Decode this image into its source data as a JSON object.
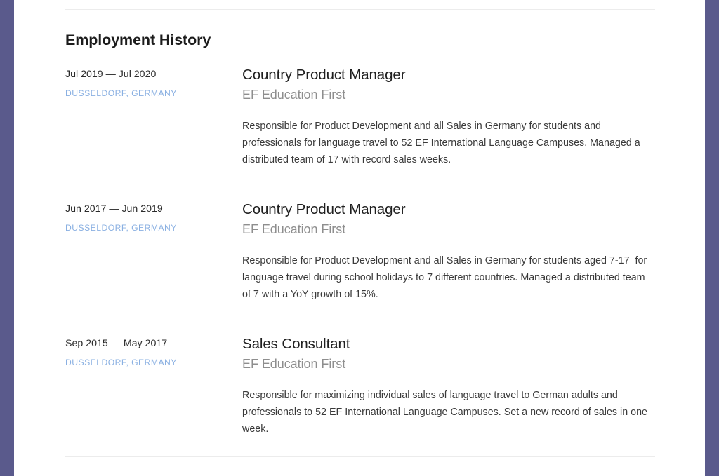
{
  "theme": {
    "page_background": "#ffffff",
    "surround_background": "#5a5a8c",
    "divider_color": "#ececec",
    "heading_color": "#1c1c1c",
    "date_color": "#2b2b2b",
    "location_color": "#8ab0e2",
    "role_color": "#1f1f1f",
    "company_color": "#8e8e8e",
    "description_color": "#3a3a3a"
  },
  "section": {
    "title": "Employment History"
  },
  "entries": [
    {
      "dates": "Jul 2019 — Jul 2020",
      "location": "DUSSELDORF, GERMANY",
      "role": "Country Product Manager",
      "company": "EF Education First",
      "description": "Responsible for Product Development and all Sales in Germany for students and professionals for language travel to 52 EF International Language Campuses. Managed a distributed team of 17 with record sales weeks."
    },
    {
      "dates": "Jun 2017 — Jun 2019",
      "location": "DUSSELDORF, GERMANY",
      "role": "Country Product Manager",
      "company": "EF Education First",
      "description": "Responsible for Product Development and all Sales in Germany for students aged 7-17  for language travel during school holidays to 7 different countries. Managed a distributed team of 7 with a YoY growth of 15%."
    },
    {
      "dates": "Sep 2015 — May 2017",
      "location": "DUSSELDORF, GERMANY",
      "role": "Sales Consultant",
      "company": "EF Education First",
      "description": "Responsible for maximizing individual sales of language travel to German adults and professionals to 52 EF International Language Campuses. Set a new record of sales in one week."
    }
  ]
}
